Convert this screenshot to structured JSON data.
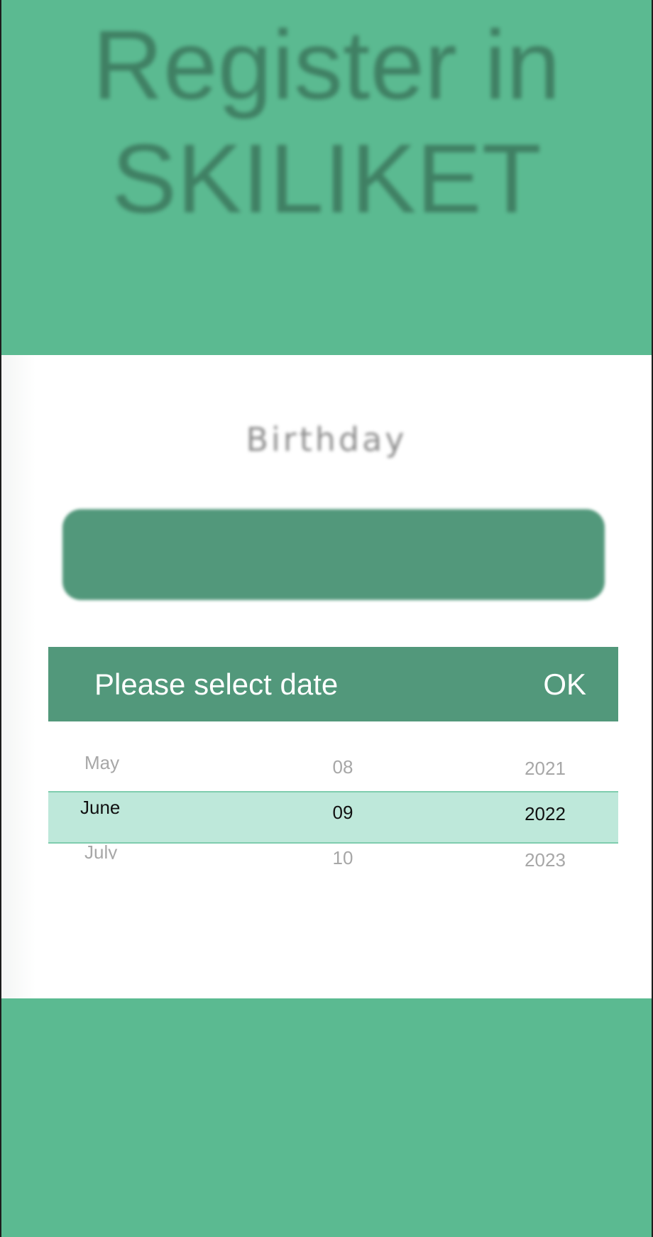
{
  "hero": {
    "title_line1": "Register in",
    "title_line2": "SKILIKET"
  },
  "form": {
    "birthday_label": "Birthday"
  },
  "date_picker": {
    "title": "Please select date",
    "ok_label": "OK",
    "month": {
      "previous": "May",
      "selected": "June",
      "next": "July"
    },
    "day": {
      "previous": "08",
      "selected": "09",
      "next": "10"
    },
    "year": {
      "previous": "2021",
      "selected": "2022",
      "next": "2023"
    }
  },
  "colors": {
    "primary_green": "#5bba91",
    "dark_green": "#52987b",
    "selection_band": "#bee8da",
    "text_dim": "#a7a7a7"
  }
}
